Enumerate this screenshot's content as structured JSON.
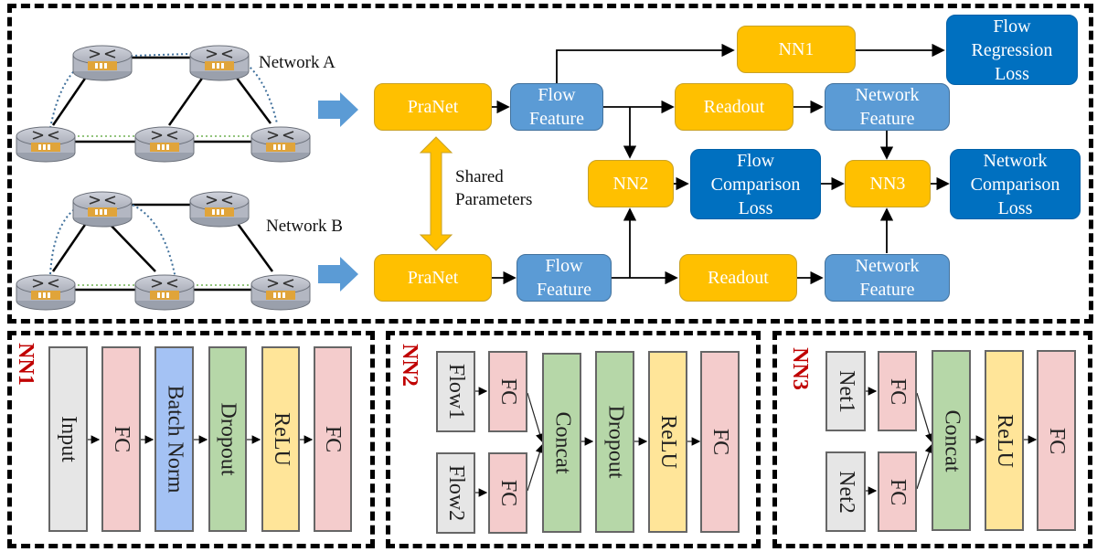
{
  "top": {
    "network_a_label": "Network A",
    "network_b_label": "Network B",
    "shared_parameters_label": "Shared\nParameters",
    "praNet_a": "PraNet",
    "praNet_b": "PraNet",
    "flow_feature_a": "Flow\nFeature",
    "flow_feature_b": "Flow\nFeature",
    "readout_a": "Readout",
    "readout_b": "Readout",
    "network_feature_a": "Network\nFeature",
    "network_feature_b": "Network\nFeature",
    "nn1": "NN1",
    "nn2": "NN2",
    "nn3": "NN3",
    "flow_regression_loss": "Flow\nRegression\nLoss",
    "flow_comparison_loss": "Flow\nComparison\nLoss",
    "network_comparison_loss": "Network\nComparison\nLoss"
  },
  "nn1_panel": {
    "title": "NN1",
    "layers": [
      "Input",
      "FC",
      "Batch Norm",
      "Dropout",
      "ReLU",
      "FC"
    ]
  },
  "nn2_panel": {
    "title": "NN2",
    "inputs": [
      "Flow1",
      "Flow2"
    ],
    "input_fcs": [
      "FC",
      "FC"
    ],
    "layers": [
      "Concat",
      "Dropout",
      "ReLU",
      "FC"
    ]
  },
  "nn3_panel": {
    "title": "NN3",
    "inputs": [
      "Net1",
      "Net2"
    ],
    "input_fcs": [
      "FC",
      "FC"
    ],
    "layers": [
      "Concat",
      "ReLU",
      "FC"
    ]
  },
  "colors": {
    "gold": "#ffc000",
    "light_blue": "#5b9bd5",
    "dark_blue": "#0070c0",
    "nn_title_red": "#c00000"
  }
}
